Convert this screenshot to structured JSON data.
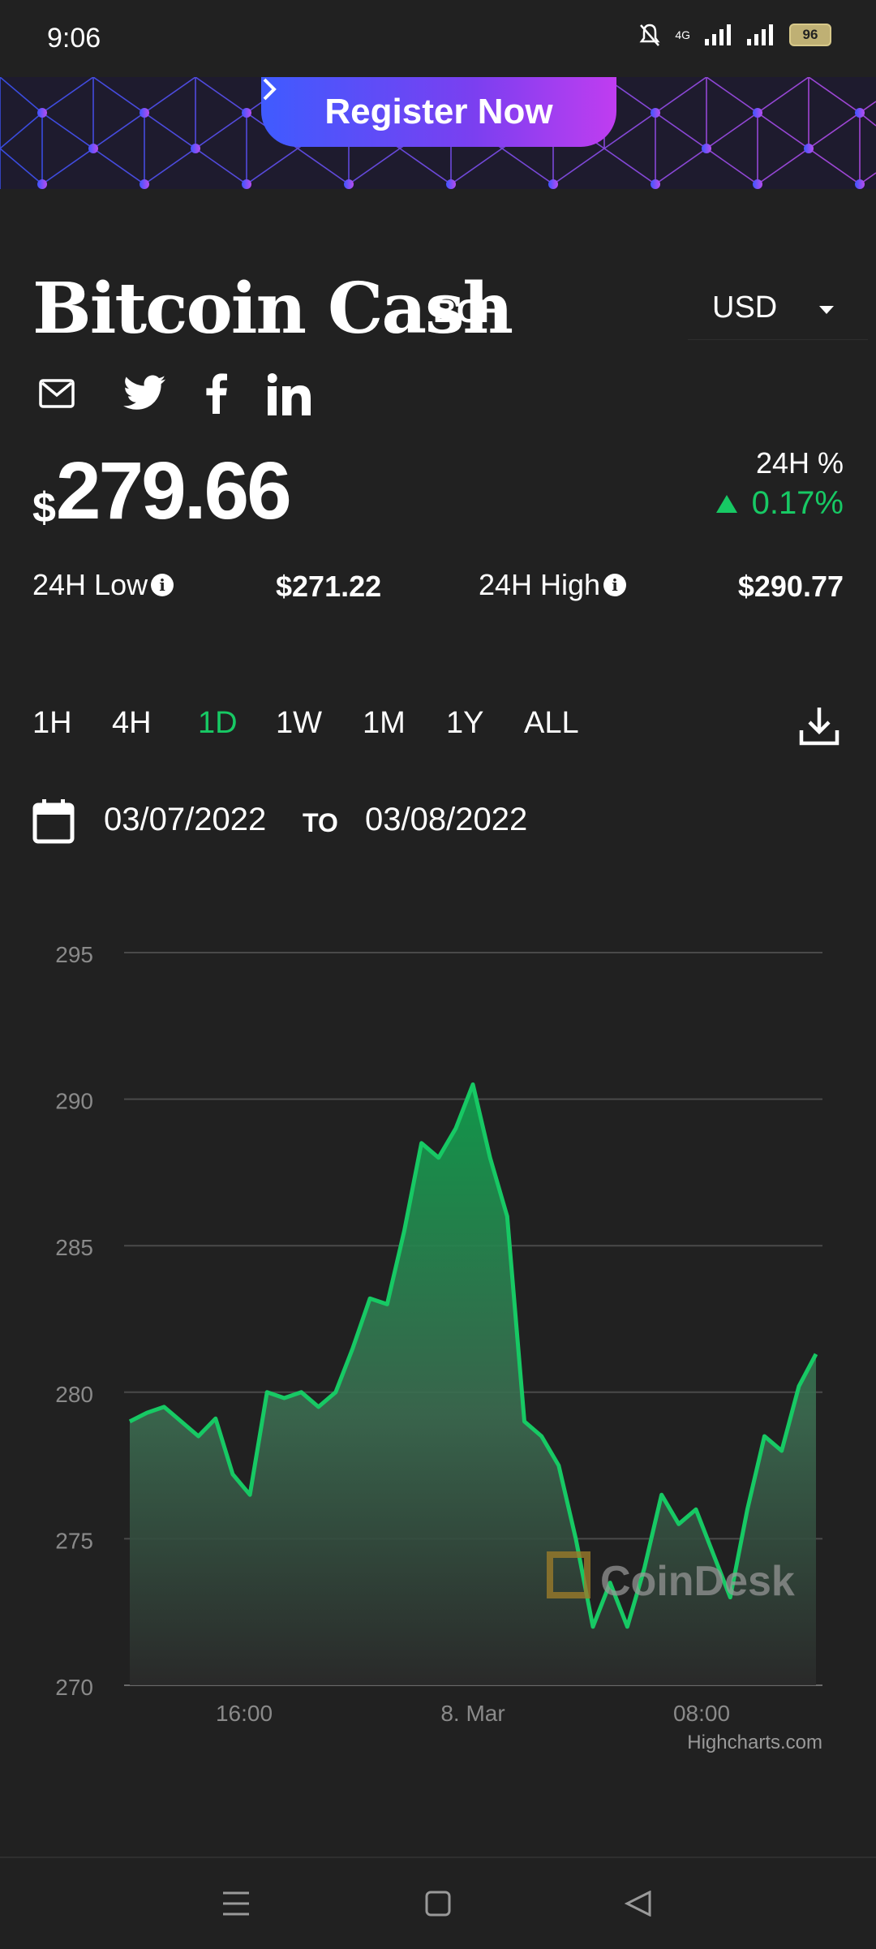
{
  "status_bar": {
    "time": "9:06",
    "network": "4G",
    "battery": "96"
  },
  "banner": {
    "cta_label": "Register Now"
  },
  "asset": {
    "name": "Bitcoin Cash",
    "ticker": "BCH"
  },
  "currency_select": {
    "value": "USD"
  },
  "share": {
    "icons": [
      "email-icon",
      "twitter-icon",
      "facebook-icon",
      "linkedin-icon"
    ]
  },
  "price": {
    "symbol": "$",
    "value": "279.66"
  },
  "change": {
    "label": "24H %",
    "value": "0.17%",
    "direction": "up",
    "color": "#17c964"
  },
  "stats": {
    "low_label": "24H Low",
    "low_value": "$271.22",
    "high_label": "24H High",
    "high_value": "$290.77"
  },
  "range_tabs": [
    {
      "label": "1H",
      "active": false
    },
    {
      "label": "4H",
      "active": false
    },
    {
      "label": "1D",
      "active": true
    },
    {
      "label": "1W",
      "active": false
    },
    {
      "label": "1M",
      "active": false
    },
    {
      "label": "1Y",
      "active": false
    },
    {
      "label": "ALL",
      "active": false
    }
  ],
  "date_range": {
    "from": "03/07/2022",
    "separator": "TO",
    "to": "03/08/2022"
  },
  "chart_data": {
    "type": "area",
    "title": "",
    "xlabel": "",
    "ylabel": "",
    "ylim": [
      270,
      295
    ],
    "yticks": [
      295,
      290,
      285,
      280,
      275,
      270
    ],
    "xtick_labels": [
      "16:00",
      "8. Mar",
      "08:00"
    ],
    "xtick_hours": [
      4,
      12,
      20
    ],
    "xlim_hours": [
      0,
      24
    ],
    "series": [
      {
        "color": "#17c964",
        "x_hours": [
          0,
          0.6,
          1.2,
          1.8,
          2.4,
          3.0,
          3.6,
          4.2,
          4.8,
          5.4,
          6.0,
          6.6,
          7.2,
          7.8,
          8.4,
          9.0,
          9.6,
          10.2,
          10.8,
          11.4,
          12.0,
          12.6,
          13.2,
          13.8,
          14.4,
          15.0,
          15.6,
          16.2,
          16.8,
          17.4,
          18.0,
          18.6,
          19.2,
          19.8,
          20.4,
          21.0,
          21.6,
          22.2,
          22.8,
          23.4,
          24.0
        ],
        "values": [
          279.0,
          279.3,
          279.5,
          279.0,
          278.5,
          279.1,
          277.2,
          276.5,
          280.0,
          279.8,
          280.0,
          279.5,
          280.0,
          281.5,
          283.2,
          283.0,
          285.5,
          288.5,
          288.0,
          289.0,
          290.5,
          288.0,
          286.0,
          279.0,
          278.5,
          277.5,
          275.0,
          272.0,
          273.5,
          272.0,
          274.0,
          276.5,
          275.5,
          276.0,
          274.5,
          273.0,
          276.0,
          278.5,
          278.0,
          280.2,
          281.3
        ]
      }
    ],
    "grid": true,
    "watermark": "CoinDesk",
    "credits": "Highcharts.com"
  },
  "nav_bar": {
    "buttons": [
      "menu",
      "home",
      "back"
    ]
  }
}
